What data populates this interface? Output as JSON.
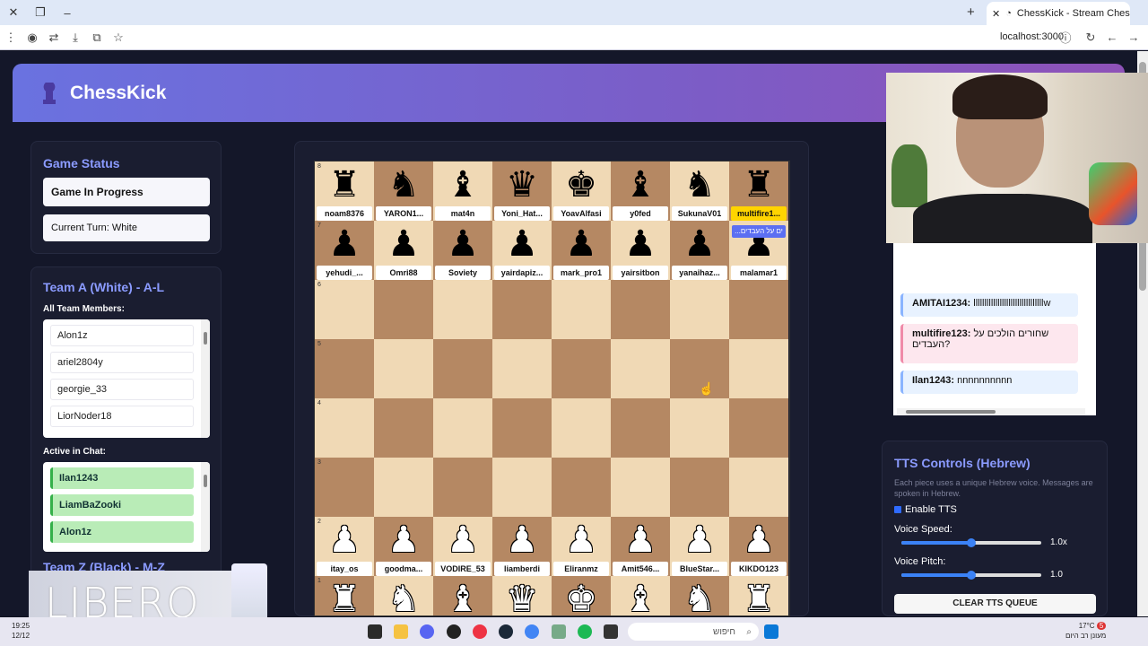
{
  "browser": {
    "tab_title": "ChessKick - Stream Chess Ga",
    "url": "localhost:3000",
    "new_tab_symbol": "+"
  },
  "header": {
    "title": "ChessKick"
  },
  "game_status": {
    "title": "Game Status",
    "status": "Game In Progress",
    "turn": "Current Turn: White"
  },
  "team_a": {
    "title": "Team A (White) - A-L",
    "members_label": "All Team Members:",
    "members": [
      "Alon1z",
      "ariel2804y",
      "georgie_33",
      "LiorNoder18"
    ],
    "active_label": "Active in Chat:",
    "active": [
      "Ilan1243",
      "LiamBaZooki",
      "Alon1z"
    ]
  },
  "team_z": {
    "title": "Team Z (Black) - M-Z"
  },
  "board": {
    "ranks": [
      "8",
      "7",
      "6",
      "5",
      "4",
      "3",
      "2",
      "1"
    ],
    "black_back": [
      "♜",
      "♞",
      "♝",
      "♛",
      "♚",
      "♝",
      "♞",
      "♜"
    ],
    "black_back_names": [
      "noam8376",
      "YARON1...",
      "mat4n",
      "Yoni_Hat...",
      "YoavAlfasi",
      "y0fed",
      "SukunaV01",
      "multifire1..."
    ],
    "black_pawns": [
      "♟",
      "♟",
      "♟",
      "♟",
      "♟",
      "♟",
      "♟",
      "♟"
    ],
    "black_pawn_names": [
      "yehudi_...",
      "Omri88",
      "Soviety",
      "yairdapiz...",
      "mark_pro1",
      "yairsitbon",
      "yanaihaz...",
      "malamar1"
    ],
    "white_pawns": [
      "♟",
      "♟",
      "♟",
      "♟",
      "♟",
      "♟",
      "♟",
      "♟"
    ],
    "white_pawn_names": [
      "itay_os",
      "goodma...",
      "VODIRE_53",
      "liamberdi",
      "Eliranmz",
      "Amit546...",
      "BlueStar...",
      "KIKDO123"
    ],
    "white_back": [
      "♜",
      "♞",
      "♝",
      "♛",
      "♚",
      "♝",
      "♞",
      "♜"
    ],
    "highlight_tooltip": "...ים על העבדים"
  },
  "chat": {
    "messages": [
      {
        "user": "AMITAI1234:",
        "text": "llllllllllllllllllllllllllllllllw",
        "style": "blue"
      },
      {
        "user": "multifire123:",
        "text": "שחורים הולכים על העבדים?",
        "style": "pink"
      },
      {
        "user": "Ilan1243:",
        "text": "nnnnnnnnnn",
        "style": "blue"
      }
    ]
  },
  "tts": {
    "title": "TTS Controls (Hebrew)",
    "description": "Each piece uses a unique Hebrew voice. Messages are spoken in Hebrew.",
    "enable_label": "Enable TTS",
    "enabled": true,
    "speed_label": "Voice Speed:",
    "speed_value": "1.0x",
    "speed_fraction": 0.5,
    "pitch_label": "Voice Pitch:",
    "pitch_value": "1.0",
    "pitch_fraction": 0.5,
    "clear_button": "CLEAR TTS QUEUE"
  },
  "overlay": {
    "brand": "LIBERO"
  },
  "taskbar": {
    "time": "19:25",
    "date": "12/12",
    "search_placeholder": "חיפוש",
    "temperature": "17°C",
    "weather": "מעונן רב היום",
    "notification_count": "5"
  },
  "colors": {
    "accent": "#8b9bff",
    "header_gradient_start": "#6a72e0",
    "header_gradient_end": "#8e52b8",
    "board_light": "#f0d9b5",
    "board_dark": "#b58863",
    "highlight": "#ffd400"
  }
}
